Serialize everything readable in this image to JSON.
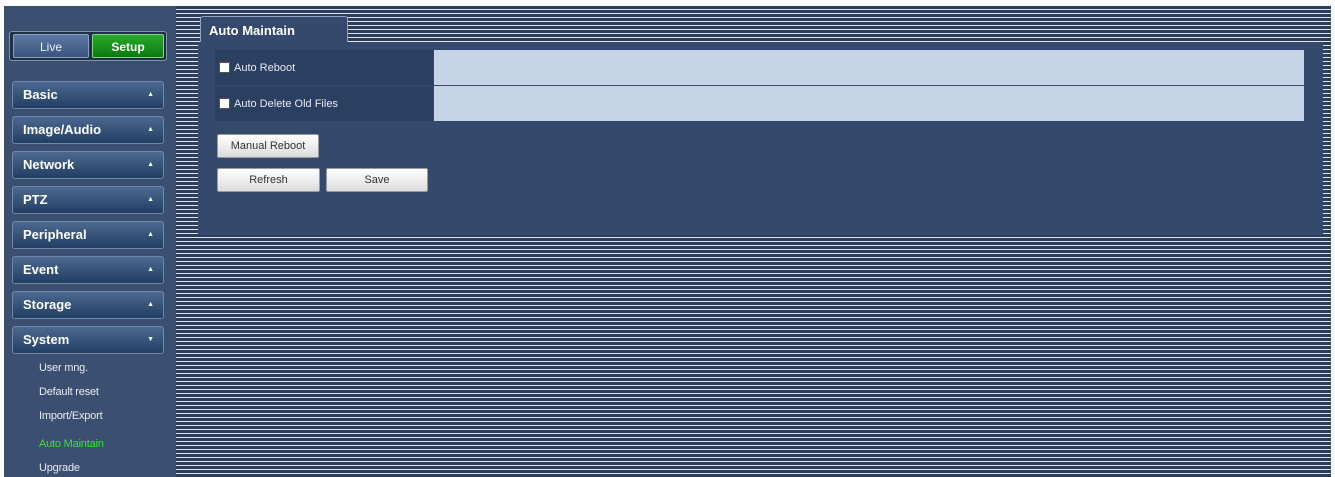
{
  "mode": {
    "live_label": "Live",
    "setup_label": "Setup"
  },
  "menu": [
    {
      "label": "Basic",
      "caret": "▲"
    },
    {
      "label": "Image/Audio",
      "caret": "▲"
    },
    {
      "label": "Network",
      "caret": "▲"
    },
    {
      "label": "PTZ",
      "caret": "▲"
    },
    {
      "label": "Peripheral",
      "caret": "▲"
    },
    {
      "label": "Event",
      "caret": "▲"
    },
    {
      "label": "Storage",
      "caret": "▲"
    },
    {
      "label": "System",
      "caret": "▼"
    }
  ],
  "system_submenu": [
    {
      "label": "User mng."
    },
    {
      "label": "Default reset"
    },
    {
      "label": "Import/Export"
    },
    {
      "label": "Auto Maintain",
      "active": true
    },
    {
      "label": "Upgrade"
    }
  ],
  "content": {
    "tab_title": "Auto Maintain",
    "rows": [
      {
        "label": "Auto Reboot",
        "checked": false
      },
      {
        "label": "Auto Delete Old Files",
        "checked": false
      }
    ],
    "manual_reboot_label": "Manual Reboot",
    "refresh_label": "Refresh",
    "save_label": "Save"
  },
  "colors": {
    "active_submenu": "#33e533",
    "setup_green": "#0b7a10",
    "panel_bg": "#34496b"
  }
}
